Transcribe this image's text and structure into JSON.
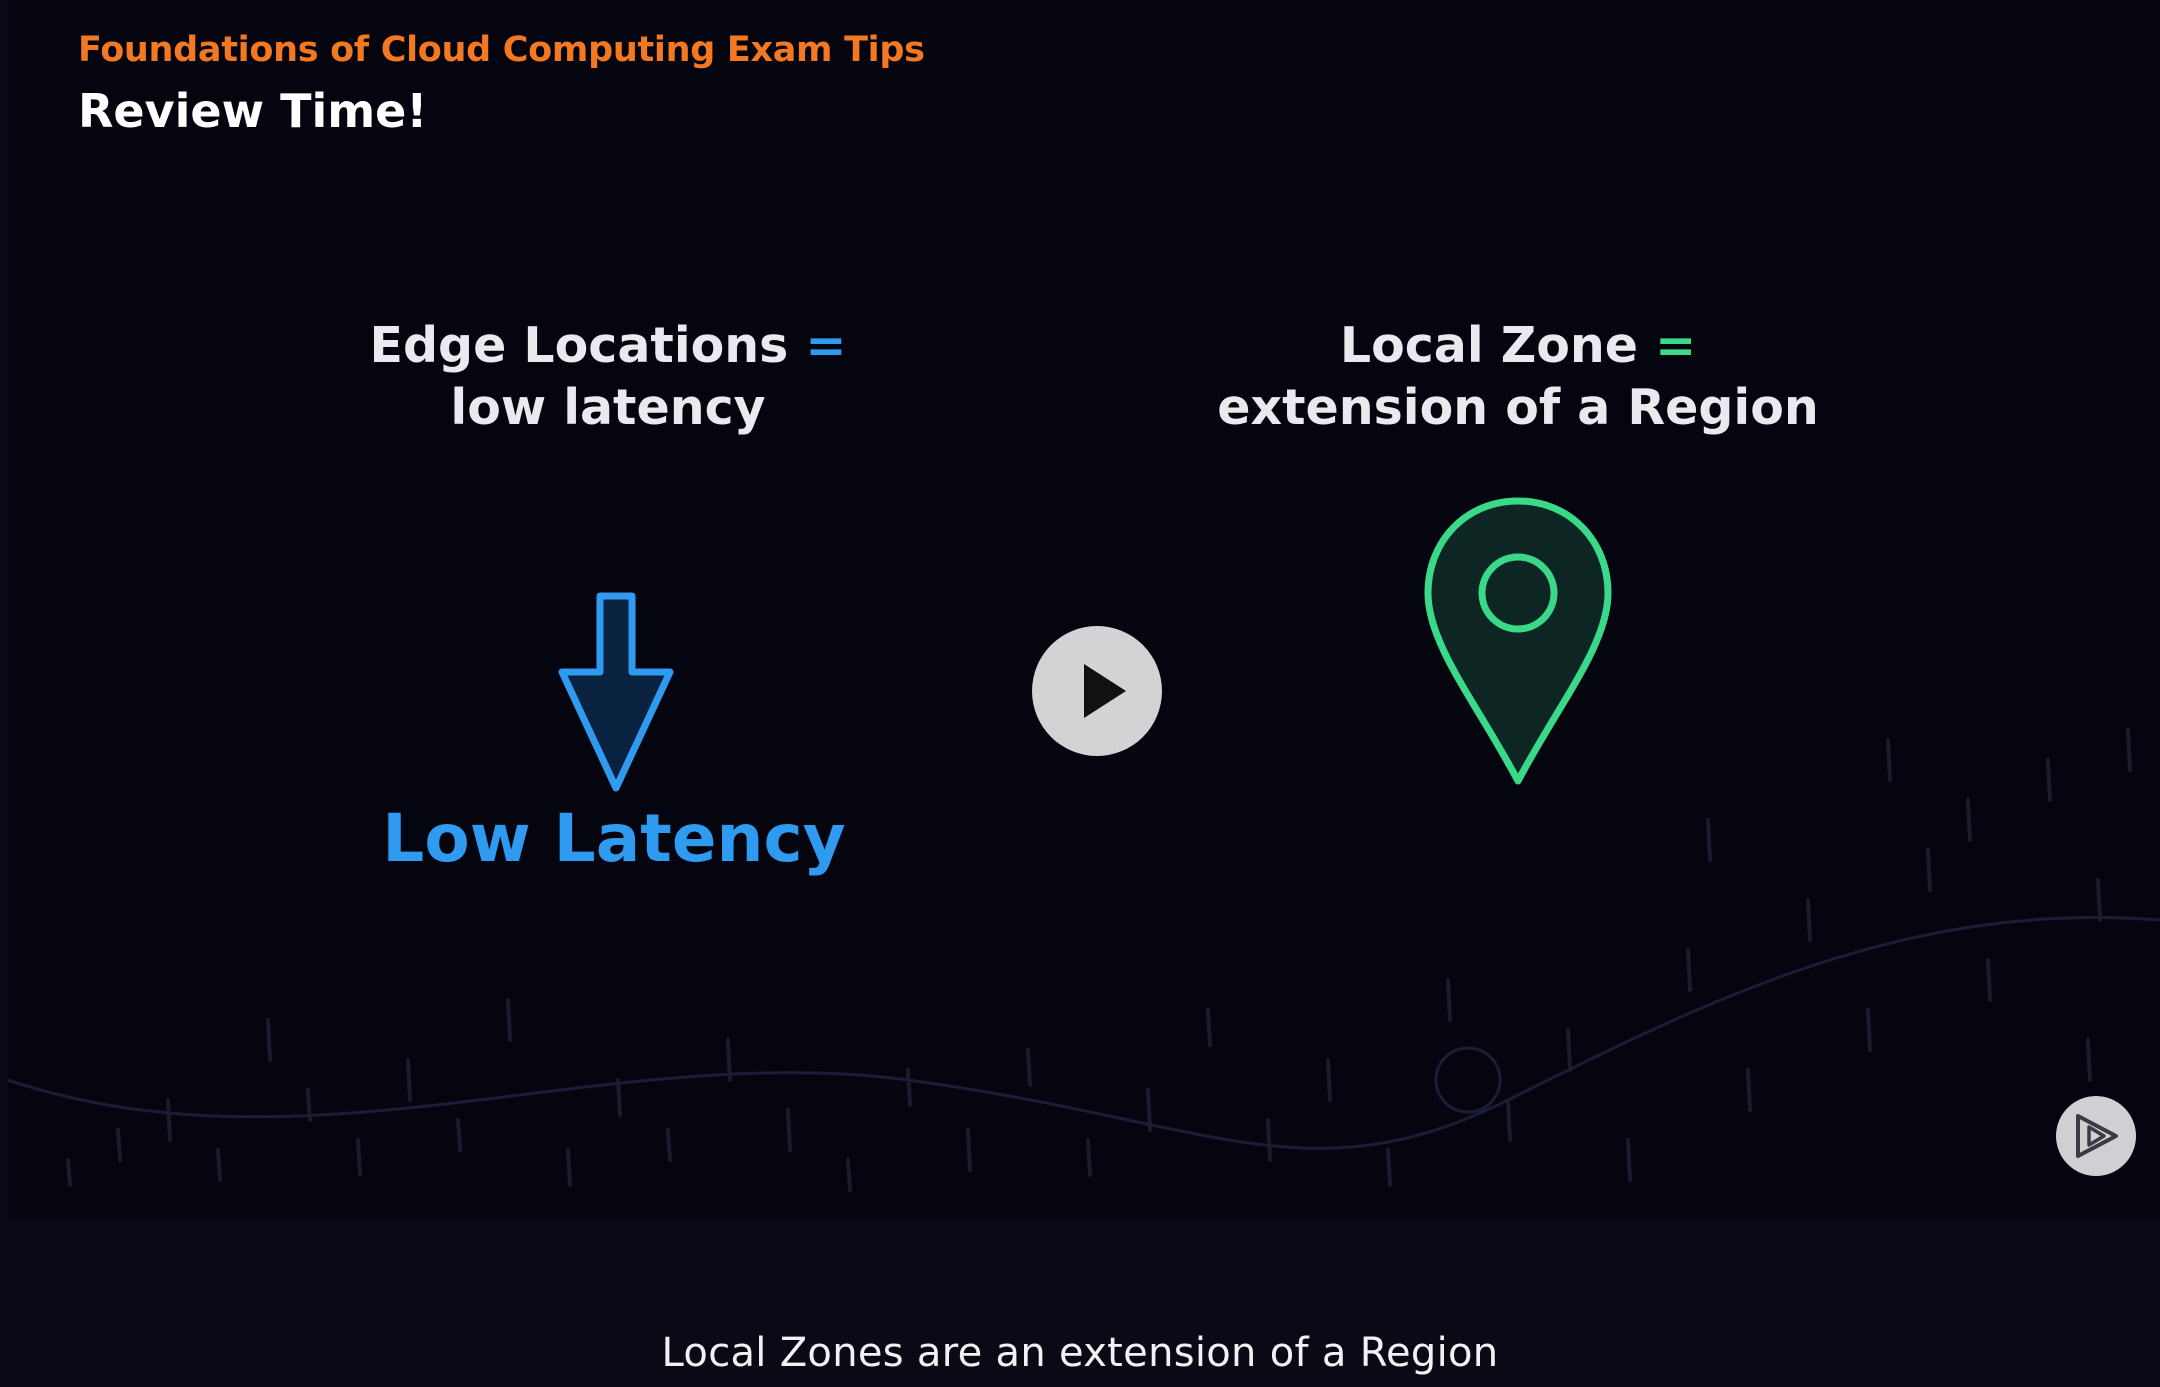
{
  "slide": {
    "course_title": "Foundations of Cloud Computing Exam Tips",
    "slide_title": "Review Time!",
    "left": {
      "heading_line1": "Edge Locations",
      "equals": "=",
      "heading_line2": "low latency",
      "icon": "down-arrow-icon",
      "label": "Low Latency",
      "accent": "#2e9bf0"
    },
    "right": {
      "heading_line1": "Local Zone",
      "equals": "=",
      "heading_line2": "extension of a Region",
      "icon": "map-pin-icon",
      "accent": "#3ad98a"
    },
    "brand_color": "#f37822"
  },
  "controls": {
    "play_icon": "play-icon",
    "next_icon": "next-clip-icon"
  },
  "caption": {
    "text": "Local Zones are an extension of a Region"
  }
}
